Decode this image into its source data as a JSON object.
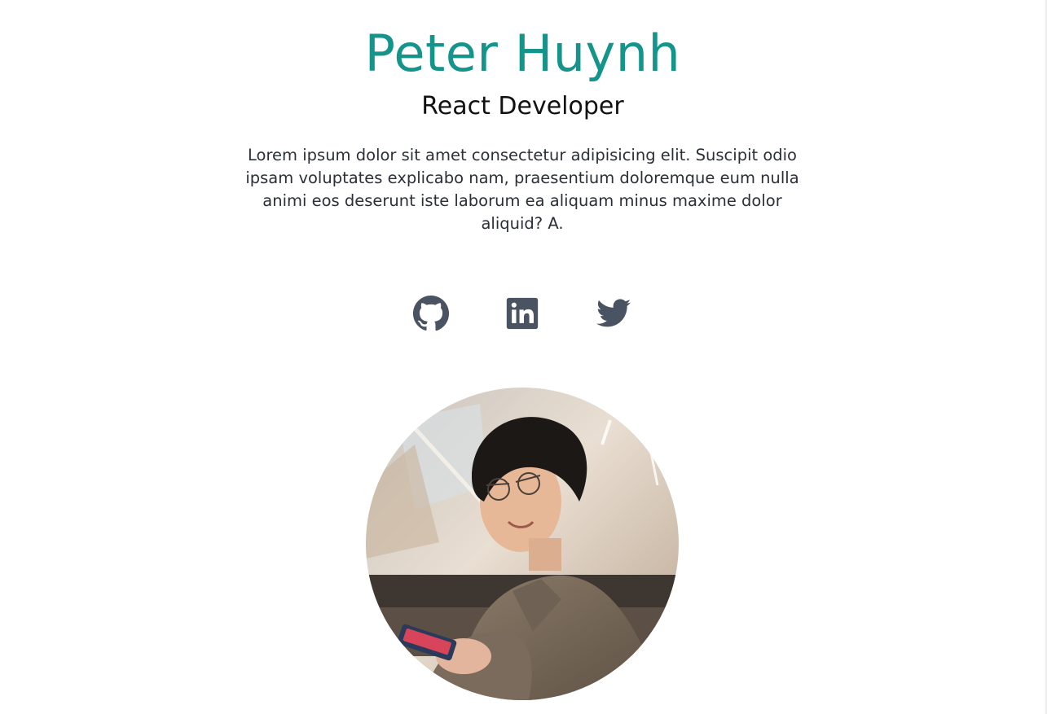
{
  "profile": {
    "name": "Peter Huynh",
    "role": "React Developer",
    "bio": "Lorem ipsum dolor sit amet consectetur adipisicing elit. Suscipit odio ipsam voluptates explicabo nam, praesentium doloremque eum nulla animi eos deserunt iste laborum ea aliquam minus maxime dolor aliquid? A."
  },
  "social": [
    {
      "icon": "github-icon"
    },
    {
      "icon": "linkedin-icon"
    },
    {
      "icon": "twitter-icon"
    }
  ],
  "colors": {
    "accent": "#14948a",
    "icon": "#4a5361",
    "text": "#2b2f38"
  }
}
